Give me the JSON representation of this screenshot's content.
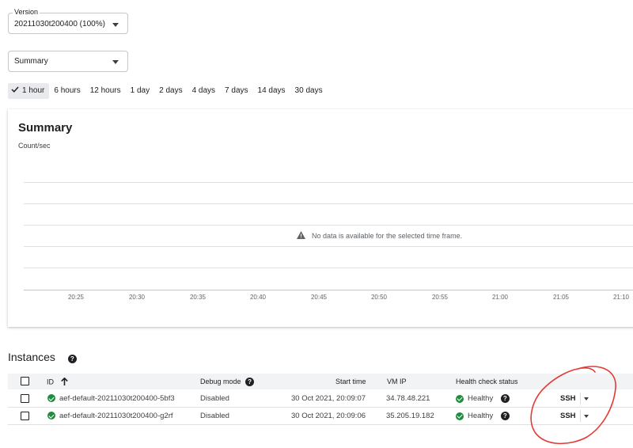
{
  "version": {
    "label": "Version",
    "value": "20211030t200400 (100%)"
  },
  "metric": {
    "value": "Summary"
  },
  "time_ranges": [
    {
      "label": "1 hour",
      "active": true
    },
    {
      "label": "6 hours",
      "active": false
    },
    {
      "label": "12 hours",
      "active": false
    },
    {
      "label": "1 day",
      "active": false
    },
    {
      "label": "2 days",
      "active": false
    },
    {
      "label": "4 days",
      "active": false
    },
    {
      "label": "7 days",
      "active": false
    },
    {
      "label": "14 days",
      "active": false
    },
    {
      "label": "30 days",
      "active": false
    }
  ],
  "summary_card": {
    "title": "Summary",
    "unit": "Count/sec",
    "no_data_message": "No data is available for the selected time frame.",
    "x_ticks": [
      "20:25",
      "20:30",
      "20:35",
      "20:40",
      "20:45",
      "20:50",
      "20:55",
      "21:00",
      "21:05",
      "21:10"
    ]
  },
  "instances": {
    "title": "Instances",
    "columns": {
      "id": "ID",
      "debug_mode": "Debug mode",
      "start_time": "Start time",
      "vm_ip": "VM IP",
      "health": "Health check status"
    },
    "rows": [
      {
        "id": "aef-default-20211030t200400-5bf3",
        "debug_mode": "Disabled",
        "start_time": "30 Oct 2021, 20:09:07",
        "vm_ip": "34.78.48.221",
        "health": "Healthy",
        "action": "SSH"
      },
      {
        "id": "aef-default-20211030t200400-g2rf",
        "debug_mode": "Disabled",
        "start_time": "30 Oct 2021, 20:09:06",
        "vm_ip": "35.205.19.182",
        "health": "Healthy",
        "action": "SSH"
      }
    ]
  },
  "colors": {
    "healthy": "#1e8e3e",
    "annotation": "#e53935"
  }
}
